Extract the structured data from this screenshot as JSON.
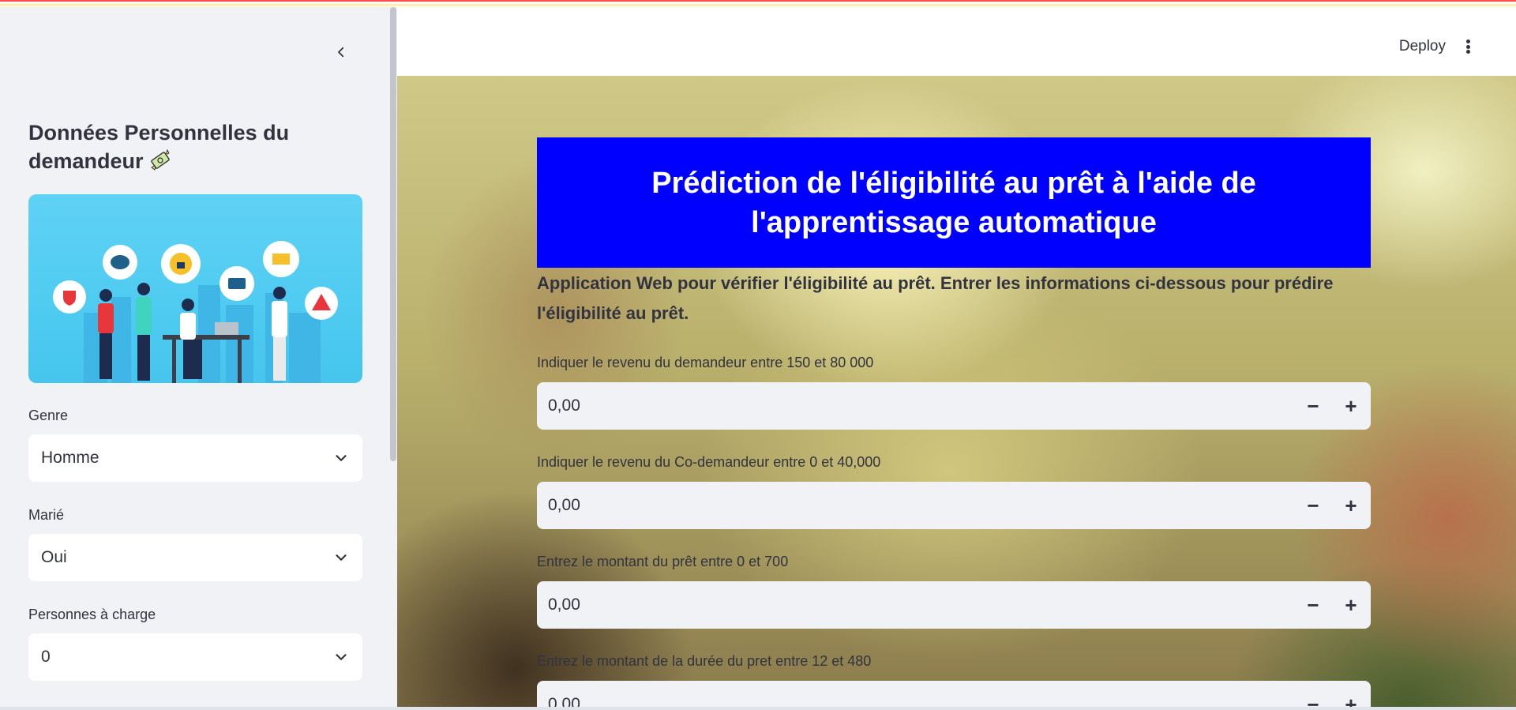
{
  "header": {
    "deploy_label": "Deploy"
  },
  "sidebar": {
    "title_line1": "Données Personnelles du",
    "title_line2": "demandeur",
    "title_emoji": "money-with-wings",
    "fields": [
      {
        "label": "Genre",
        "value": "Homme"
      },
      {
        "label": "Marié",
        "value": "Oui"
      },
      {
        "label": "Personnes à charge",
        "value": "0"
      }
    ]
  },
  "main": {
    "banner_title": "Prédiction de l'éligibilité au prêt à l'aide de l'apprentissage automatique",
    "banner_color": "#0000ff",
    "subtitle": "Application Web pour vérifier l'éligibilité au prêt. Entrer les informations ci-dessous pour prédire l'éligibilité au prêt.",
    "inputs": [
      {
        "label": "Indiquer le revenu du demandeur entre 150 et 80 000",
        "value": "0,00"
      },
      {
        "label": "Indiquer le revenu du Co-demandeur entre 0 et 40,000",
        "value": "0,00"
      },
      {
        "label": "Entrez le montant du prêt entre 0 et 700",
        "value": "0,00"
      },
      {
        "label": "Entrez le montant de la durée du pret entre 12 et 480",
        "value": "0,00"
      }
    ],
    "minus_label": "−",
    "plus_label": "+"
  },
  "colors": {
    "accent": "#ff4b4b",
    "sidebar_bg": "#f0f2f6",
    "text": "#31333f"
  }
}
